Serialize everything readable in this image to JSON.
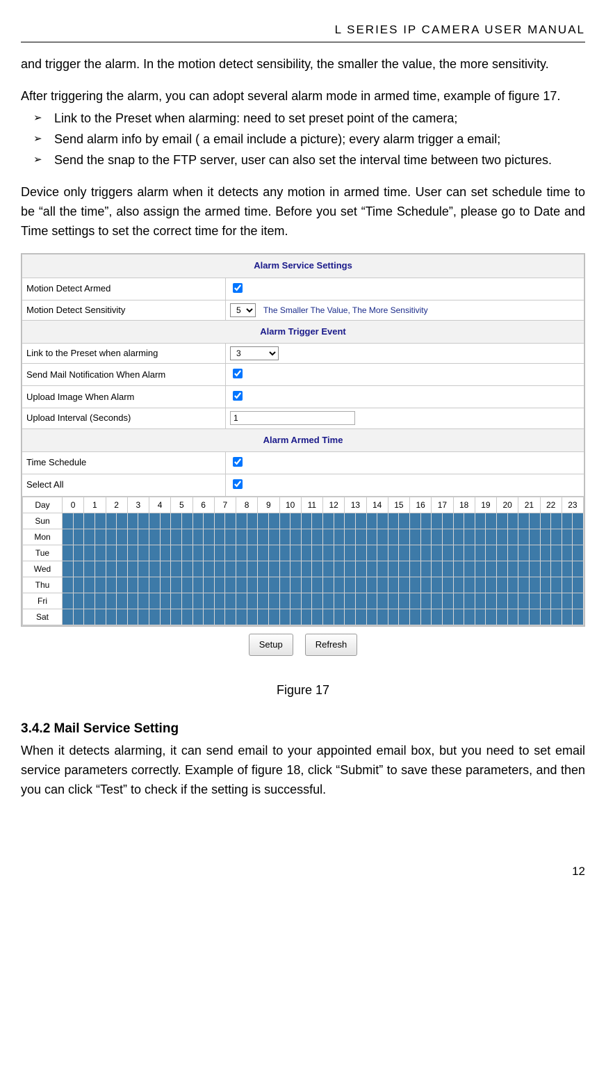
{
  "header": "L  SERIES  IP  CAMERA  USER  MANUAL",
  "para1": "and trigger the alarm. In the motion detect sensibility, the smaller the value, the more sensitivity.",
  "para2": "After triggering the alarm, you can adopt several alarm mode in armed time, example of figure 17.",
  "bullets": [
    "Link to the Preset when alarming: need to set preset point of the camera;",
    "Send alarm info by email ( a email include a picture); every alarm trigger a email;",
    "Send the snap to the FTP server, user can also set the interval time between two pictures."
  ],
  "para3": "Device only triggers alarm when it detects any motion in armed time. User can set schedule time to be “all the time”, also assign the armed time. Before you set “Time Schedule”, please go to Date and Time settings to set the correct time for the item.",
  "settings": {
    "title": "Alarm Service Settings",
    "motion_detect_armed": "Motion Detect Armed",
    "motion_detect_sens": "Motion Detect Sensitivity",
    "sens_value": "5",
    "sens_help": "The Smaller The Value, The More Sensitivity",
    "trigger_title": "Alarm Trigger Event",
    "link_preset": "Link to the Preset when alarming",
    "link_preset_value": "3",
    "send_mail": "Send Mail Notification When Alarm",
    "upload_image": "Upload Image When Alarm",
    "upload_interval": "Upload Interval (Seconds)",
    "upload_interval_value": "1",
    "armed_title": "Alarm Armed Time",
    "time_schedule": "Time Schedule",
    "select_all": "Select All"
  },
  "schedule": {
    "day_label": "Day",
    "hours": [
      "0",
      "1",
      "2",
      "3",
      "4",
      "5",
      "6",
      "7",
      "8",
      "9",
      "10",
      "11",
      "12",
      "13",
      "14",
      "15",
      "16",
      "17",
      "18",
      "19",
      "20",
      "21",
      "22",
      "23"
    ],
    "days": [
      "Sun",
      "Mon",
      "Tue",
      "Wed",
      "Thu",
      "Fri",
      "Sat"
    ]
  },
  "buttons": {
    "setup": "Setup",
    "refresh": "Refresh"
  },
  "figure_caption": "Figure 17",
  "section_heading": "3.4.2   Mail Service Setting",
  "section_body": "When it detects alarming, it can send email to your appointed email box, but you need to set email service parameters correctly. Example of figure 18, click “Submit” to save these parameters, and then you can click “Test” to check if the setting is successful.",
  "page_number": "12"
}
